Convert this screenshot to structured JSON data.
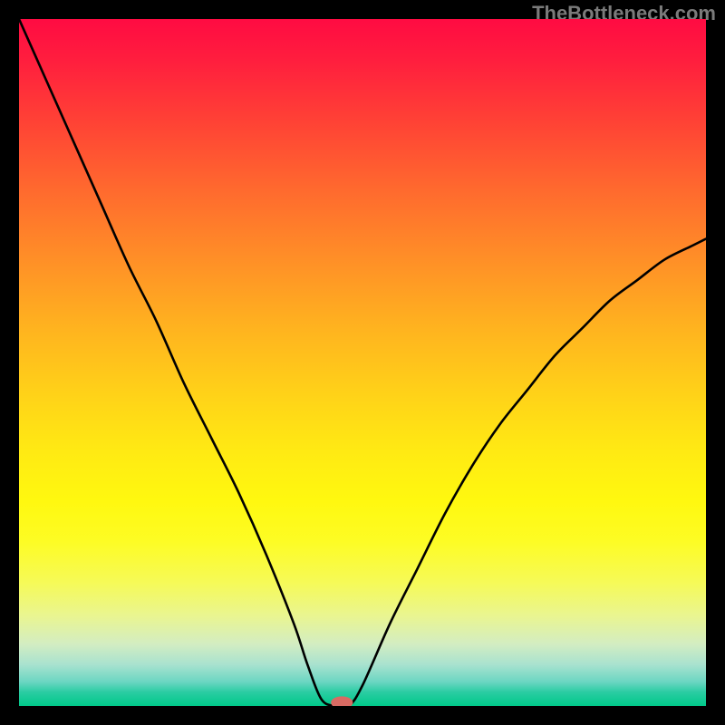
{
  "watermark": "TheBottleneck.com",
  "chart_data": {
    "type": "line",
    "title": "",
    "xlabel": "",
    "ylabel": "",
    "xlim": [
      0,
      100
    ],
    "ylim": [
      0,
      100
    ],
    "grid": false,
    "legend": false,
    "background_gradient": {
      "stops": [
        {
          "pos": 0.0,
          "color": "#ff0b42"
        },
        {
          "pos": 0.25,
          "color": "#ff6a2e"
        },
        {
          "pos": 0.55,
          "color": "#ffd318"
        },
        {
          "pos": 0.82,
          "color": "#f6fa57"
        },
        {
          "pos": 0.94,
          "color": "#a8e2cf"
        },
        {
          "pos": 1.0,
          "color": "#00c98a"
        }
      ]
    },
    "series": [
      {
        "name": "bottleneck-curve",
        "x": [
          0,
          4,
          8,
          12,
          16,
          20,
          24,
          28,
          32,
          36,
          40,
          42,
          44,
          46,
          48,
          50,
          54,
          58,
          62,
          66,
          70,
          74,
          78,
          82,
          86,
          90,
          94,
          98,
          100
        ],
        "values": [
          100,
          91,
          82,
          73,
          64,
          56,
          47,
          39,
          31,
          22,
          12,
          6,
          1,
          0,
          0,
          3,
          12,
          20,
          28,
          35,
          41,
          46,
          51,
          55,
          59,
          62,
          65,
          67,
          68
        ]
      }
    ],
    "marker": {
      "name": "optimal-point",
      "x": 47,
      "y": 0.5,
      "rx": 1.6,
      "ry": 0.9,
      "color": "#d86a63"
    }
  }
}
